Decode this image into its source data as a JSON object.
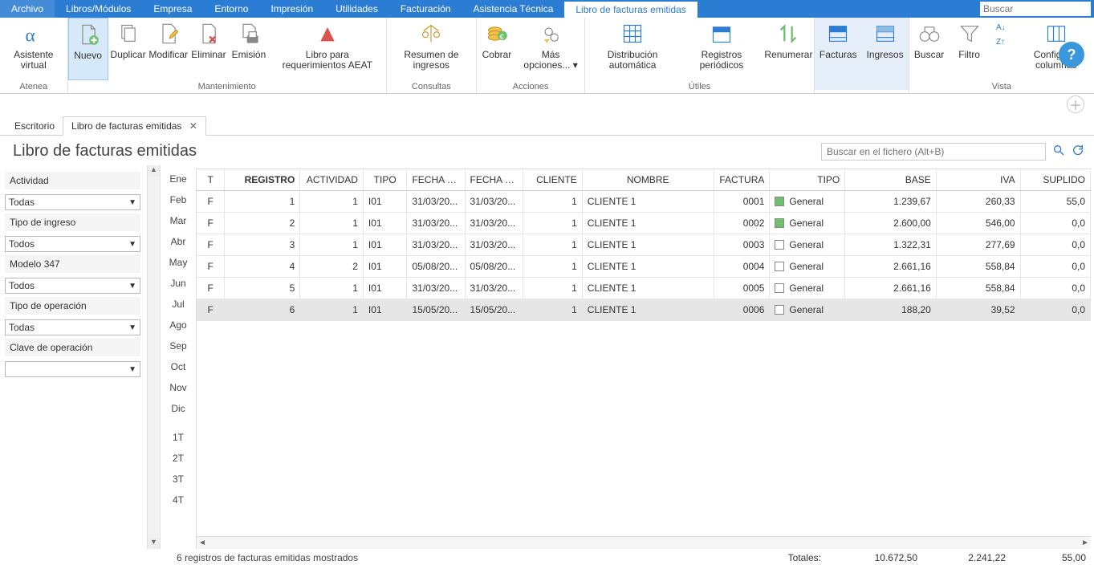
{
  "menubar": {
    "items": [
      "Archivo",
      "Libros/Módulos",
      "Empresa",
      "Entorno",
      "Impresión",
      "Utilidades",
      "Facturación",
      "Asistencia Técnica"
    ],
    "active_tab": "Libro de facturas emitidas",
    "search_placeholder": "Buscar"
  },
  "ribbon": {
    "groups": [
      {
        "label": "Atenea",
        "buttons": [
          {
            "key": "asistente",
            "label": "Asistente virtual"
          }
        ]
      },
      {
        "label": "Mantenimiento",
        "buttons": [
          {
            "key": "nuevo",
            "label": "Nuevo",
            "selected": true
          },
          {
            "key": "duplicar",
            "label": "Duplicar"
          },
          {
            "key": "modificar",
            "label": "Modificar"
          },
          {
            "key": "eliminar",
            "label": "Eliminar"
          },
          {
            "key": "emision",
            "label": "Emisión"
          },
          {
            "key": "libro-aeat",
            "label": "Libro para requerimientos AEAT"
          }
        ]
      },
      {
        "label": "Consultas",
        "buttons": [
          {
            "key": "resumen",
            "label": "Resumen de ingresos"
          }
        ]
      },
      {
        "label": "Acciones",
        "buttons": [
          {
            "key": "cobrar",
            "label": "Cobrar"
          },
          {
            "key": "opciones",
            "label": "Más opciones... ▾"
          }
        ]
      },
      {
        "label": "Útiles",
        "buttons": [
          {
            "key": "distribucion",
            "label": "Distribución automática"
          },
          {
            "key": "registros",
            "label": "Registros periódicos"
          },
          {
            "key": "renumerar",
            "label": "Renumerar"
          }
        ]
      },
      {
        "label": "",
        "buttons": [
          {
            "key": "facturas",
            "label": "Facturas",
            "active": true
          },
          {
            "key": "ingresos",
            "label": "Ingresos",
            "active": true
          }
        ]
      },
      {
        "label": "Vista",
        "buttons": [
          {
            "key": "buscar",
            "label": "Buscar"
          },
          {
            "key": "filtro",
            "label": "Filtro"
          },
          {
            "key": "sort",
            "label": ""
          },
          {
            "key": "config-cols",
            "label": "Configurar columnas"
          }
        ]
      }
    ]
  },
  "workspace_tabs": [
    {
      "label": "Escritorio",
      "active": false
    },
    {
      "label": "Libro de facturas emitidas",
      "active": true,
      "closeable": true
    }
  ],
  "page_title": "Libro de facturas emitidas",
  "file_search_placeholder": "Buscar en el fichero (Alt+B)",
  "filters": [
    {
      "label": "Actividad",
      "value": "Todas"
    },
    {
      "label": "Tipo de ingreso",
      "value": "Todos"
    },
    {
      "label": "Modelo 347",
      "value": "Todos"
    },
    {
      "label": "Tipo de operación",
      "value": "Todas"
    },
    {
      "label": "Clave de operación",
      "value": ""
    }
  ],
  "months": [
    "Ene",
    "Feb",
    "Mar",
    "Abr",
    "May",
    "Jun",
    "Jul",
    "Ago",
    "Sep",
    "Oct",
    "Nov",
    "Dic",
    "",
    "1T",
    "2T",
    "3T",
    "4T"
  ],
  "table": {
    "columns": [
      "T",
      "REGISTRO",
      "ACTIVIDAD",
      "TIPO",
      "FECHA R...",
      "FECHA E...",
      "CLIENTE",
      "NOMBRE",
      "FACTURA",
      "TIPO",
      "BASE",
      "IVA",
      "SUPLIDO"
    ],
    "rows": [
      {
        "t": "F",
        "registro": "1",
        "actividad": "1",
        "tipo": "I01",
        "f_r": "31/03/20...",
        "f_e": "31/03/20...",
        "cliente": "1",
        "nombre": "CLIENTE 1",
        "factura": "0001",
        "tipo2": "General",
        "swatch": "green",
        "base": "1.239,67",
        "iva": "260,33",
        "suplido": "55,0"
      },
      {
        "t": "F",
        "registro": "2",
        "actividad": "1",
        "tipo": "I01",
        "f_r": "31/03/20...",
        "f_e": "31/03/20...",
        "cliente": "1",
        "nombre": "CLIENTE 1",
        "factura": "0002",
        "tipo2": "General",
        "swatch": "green",
        "base": "2.600,00",
        "iva": "546,00",
        "suplido": "0,0"
      },
      {
        "t": "F",
        "registro": "3",
        "actividad": "1",
        "tipo": "I01",
        "f_r": "31/03/20...",
        "f_e": "31/03/20...",
        "cliente": "1",
        "nombre": "CLIENTE 1",
        "factura": "0003",
        "tipo2": "General",
        "swatch": "white",
        "base": "1.322,31",
        "iva": "277,69",
        "suplido": "0,0"
      },
      {
        "t": "F",
        "registro": "4",
        "actividad": "2",
        "tipo": "I01",
        "f_r": "05/08/20...",
        "f_e": "05/08/20...",
        "cliente": "1",
        "nombre": "CLIENTE 1",
        "factura": "0004",
        "tipo2": "General",
        "swatch": "white",
        "base": "2.661,16",
        "iva": "558,84",
        "suplido": "0,0"
      },
      {
        "t": "F",
        "registro": "5",
        "actividad": "1",
        "tipo": "I01",
        "f_r": "31/03/20...",
        "f_e": "31/03/20...",
        "cliente": "1",
        "nombre": "CLIENTE 1",
        "factura": "0005",
        "tipo2": "General",
        "swatch": "white",
        "base": "2.661,16",
        "iva": "558,84",
        "suplido": "0,0"
      },
      {
        "t": "F",
        "registro": "6",
        "actividad": "1",
        "tipo": "I01",
        "f_r": "15/05/20...",
        "f_e": "15/05/20...",
        "cliente": "1",
        "nombre": "CLIENTE 1",
        "factura": "0006",
        "tipo2": "General",
        "swatch": "white",
        "base": "188,20",
        "iva": "39,52",
        "suplido": "0,0",
        "selected": true
      }
    ]
  },
  "status_text": "6 registros de facturas emitidas mostrados",
  "totals": {
    "label": "Totales:",
    "base": "10.672,50",
    "iva": "2.241,22",
    "suplido": "55,00"
  }
}
